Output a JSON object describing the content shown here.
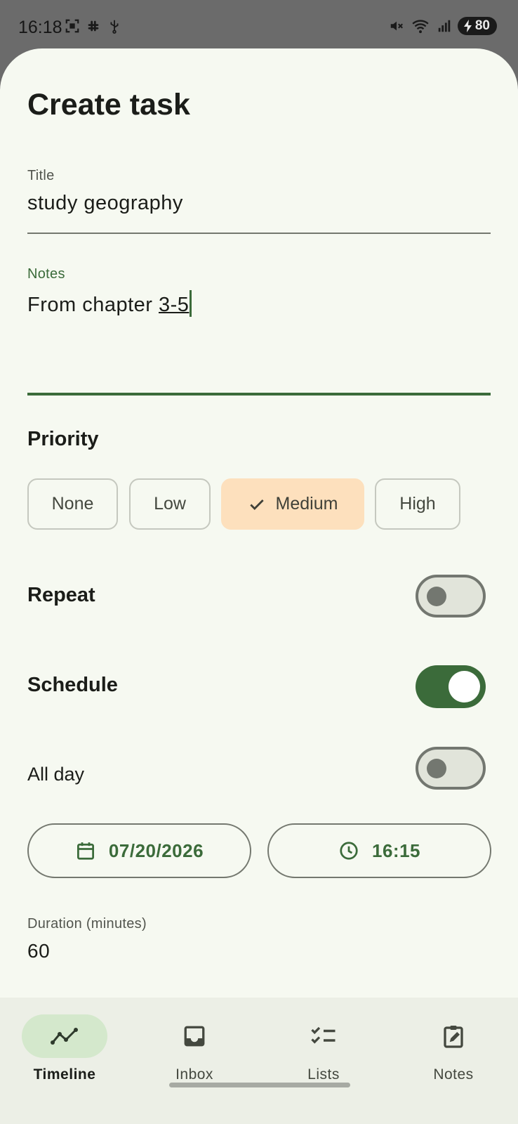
{
  "status_bar": {
    "time": "16:18",
    "battery": "80",
    "left_icons": [
      "screenshot-icon",
      "slack-icon",
      "usb-icon"
    ],
    "right_icons": [
      "mute-icon",
      "wifi-icon",
      "signal-icon",
      "battery-icon"
    ]
  },
  "page": {
    "title": "Create task"
  },
  "form": {
    "title_label": "Title",
    "title_value": "study geography",
    "notes_label": "Notes",
    "notes_value_prefix": "From chapter ",
    "notes_value_underlined": "3-5",
    "priority_label": "Priority",
    "priority_options": [
      "None",
      "Low",
      "Medium",
      "High"
    ],
    "priority_selected": "Medium",
    "repeat_label": "Repeat",
    "repeat_on": false,
    "schedule_label": "Schedule",
    "schedule_on": true,
    "allday_label": "All day",
    "allday_on": false,
    "date_value": "07/20/2026",
    "time_value": "16:15",
    "duration_label": "Duration (minutes)",
    "duration_value": "60"
  },
  "nav": {
    "items": [
      {
        "label": "Timeline",
        "icon": "timeline-icon",
        "active": true
      },
      {
        "label": "Inbox",
        "icon": "inbox-icon",
        "active": false
      },
      {
        "label": "Lists",
        "icon": "checklist-icon",
        "active": false
      },
      {
        "label": "Notes",
        "icon": "note-edit-icon",
        "active": false
      }
    ]
  },
  "colors": {
    "accent": "#3b6b3a",
    "background": "#f6f9f1",
    "selected_chip": "#fde0bd",
    "nav_active": "#d4e8cc"
  }
}
